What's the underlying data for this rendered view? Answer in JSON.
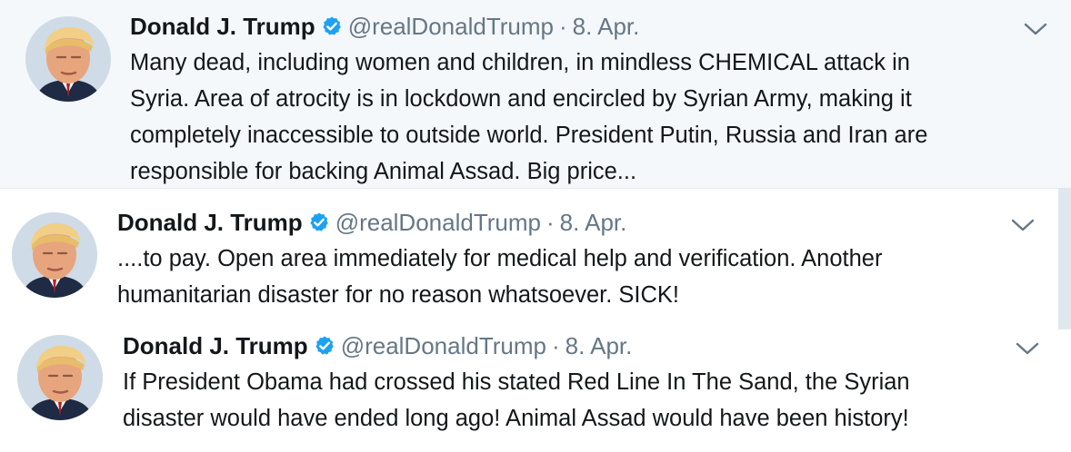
{
  "colors": {
    "secondary_text": "#657786",
    "verified_blue": "#1da1f2",
    "highlight_bg": "#f5f8fa"
  },
  "tweets": [
    {
      "author": "Donald J. Trump",
      "handle": "@realDonaldTrump",
      "separator": "·",
      "time": "8. Apr.",
      "verified_icon": "verified-badge-icon",
      "menu_icon": "chevron-down-icon",
      "lines": [
        "Many dead, including women and children, in mindless CHEMICAL attack in",
        "Syria. Area of atrocity is in lockdown and encircled by Syrian Army, making it",
        "completely inaccessible to outside world. President Putin, Russia and Iran are",
        "responsible for backing Animal Assad. Big price..."
      ]
    },
    {
      "author": "Donald J. Trump",
      "handle": "@realDonaldTrump",
      "separator": "·",
      "time": "8. Apr.",
      "verified_icon": "verified-badge-icon",
      "menu_icon": "chevron-down-icon",
      "lines": [
        "....to pay. Open area immediately for medical help and verification. Another",
        "humanitarian disaster for no reason whatsoever. SICK!"
      ]
    },
    {
      "author": "Donald J. Trump",
      "handle": "@realDonaldTrump",
      "separator": "·",
      "time": "8. Apr.",
      "verified_icon": "verified-badge-icon",
      "menu_icon": "chevron-down-icon",
      "lines": [
        "If President Obama had crossed his stated Red Line In The Sand, the Syrian",
        "disaster would have ended long ago! Animal Assad would have been history!"
      ]
    }
  ]
}
